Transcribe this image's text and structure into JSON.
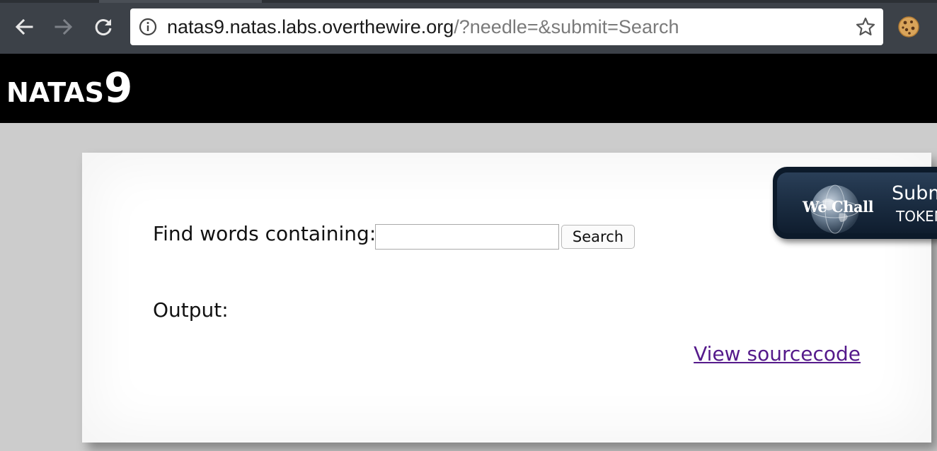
{
  "browser": {
    "url_host": "natas9.natas.labs.overthewire.org",
    "url_rest": "/?needle=&submit=Search",
    "icons": {
      "back": "arrow-left-icon",
      "forward": "arrow-right-icon",
      "reload": "reload-icon",
      "info": "info-icon",
      "bookmark": "star-icon",
      "extension": "cookie-icon"
    }
  },
  "header": {
    "title_name": "NATAS",
    "title_level": "9",
    "background": "#000000"
  },
  "form": {
    "label": "Find words containing:",
    "needle_value": "",
    "submit_label": "Search"
  },
  "output": {
    "label": "Output:"
  },
  "footer": {
    "source_link": "View sourcecode",
    "link_color": "#551a8b"
  },
  "wechall": {
    "logo_text": "We Chall",
    "submit_text": "Submit",
    "token_text": "TOKEN"
  }
}
